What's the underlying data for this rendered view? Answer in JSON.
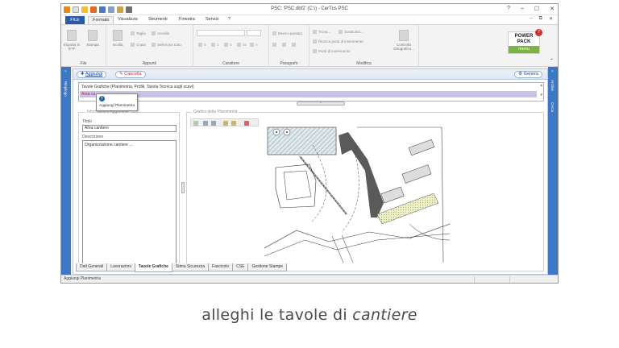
{
  "window": {
    "title": "PSC: 'PSC.dbf2'  (C:\\) - CerTus PSC",
    "controls": [
      "?",
      "–",
      "☐",
      "✕"
    ]
  },
  "tabs": [
    {
      "label": "FILE"
    },
    {
      "label": "Formato"
    },
    {
      "label": "Visualizza"
    },
    {
      "label": "Strumenti"
    },
    {
      "label": "Finestra"
    },
    {
      "label": "Servizi"
    },
    {
      "label": "?"
    }
  ],
  "ribbon": {
    "file_group": {
      "label": "File",
      "export": "Esporta in RTF",
      "print": "Stampa"
    },
    "appunti_group": {
      "label": "Appunti",
      "paste": "Incolla",
      "cut": "Taglia",
      "copy": "Copia",
      "undo": "Annulla",
      "select_all": "Seleziona tutto"
    },
    "carattere_group": {
      "label": "Carattere"
    },
    "paragrafo_group": {
      "label": "Paragrafo",
      "bullet": "Elenco puntato"
    },
    "modifica_group": {
      "label": "Modifica",
      "find": "Trova...",
      "replace": "Sostituisci...",
      "find_points": "Ricerca punti di inserimento",
      "insert_points": "Punti di inserimento",
      "spellcheck": "Controllo Ortografico..."
    },
    "powerpack": {
      "line1": "POWER",
      "line2": "PACK",
      "menu": "menu",
      "badge": "7"
    }
  },
  "side": {
    "left": "Riepilogo",
    "right1": "Archivi",
    "right2": "Cerca"
  },
  "toolbar": {
    "add": "Aggiungi",
    "delete": "Cancella",
    "generate": "Genera"
  },
  "tooltip": {
    "text": "Aggiungi Planimetria"
  },
  "grid": {
    "row1": "Tavole Grafiche (Planimetria, Profili, Tavola Tecnica sugli scavi)",
    "row2": "Area ca"
  },
  "info_panel": {
    "legend": "Informazioni Aggiuntive",
    "title_label": "Titolo",
    "title_value": "Area cantiere",
    "desc_label": "Descrizione",
    "desc_value": "Organizzazione cantiere ..."
  },
  "graph_panel": {
    "legend": "Grafico della Planimetria"
  },
  "bottom_tabs": [
    {
      "label": "Dati Generali",
      "active": false
    },
    {
      "label": "Lavorazioni",
      "active": false
    },
    {
      "label": "Tavole Grafiche",
      "active": true
    },
    {
      "label": "Stima Sicurezza",
      "active": false
    },
    {
      "label": "Fascicolo",
      "active": false
    },
    {
      "label": "CSE",
      "active": false
    },
    {
      "label": "Gestione Stampe",
      "active": false
    }
  ],
  "status": {
    "text": "Aggiungi Planimetria"
  },
  "caption": {
    "before": "alleghi le tavole di ",
    "italic": "cantiere"
  },
  "colors": {
    "accent": "#2a5ba8",
    "side": "#3d78c5",
    "highlight_row": "#c9c1e8"
  }
}
